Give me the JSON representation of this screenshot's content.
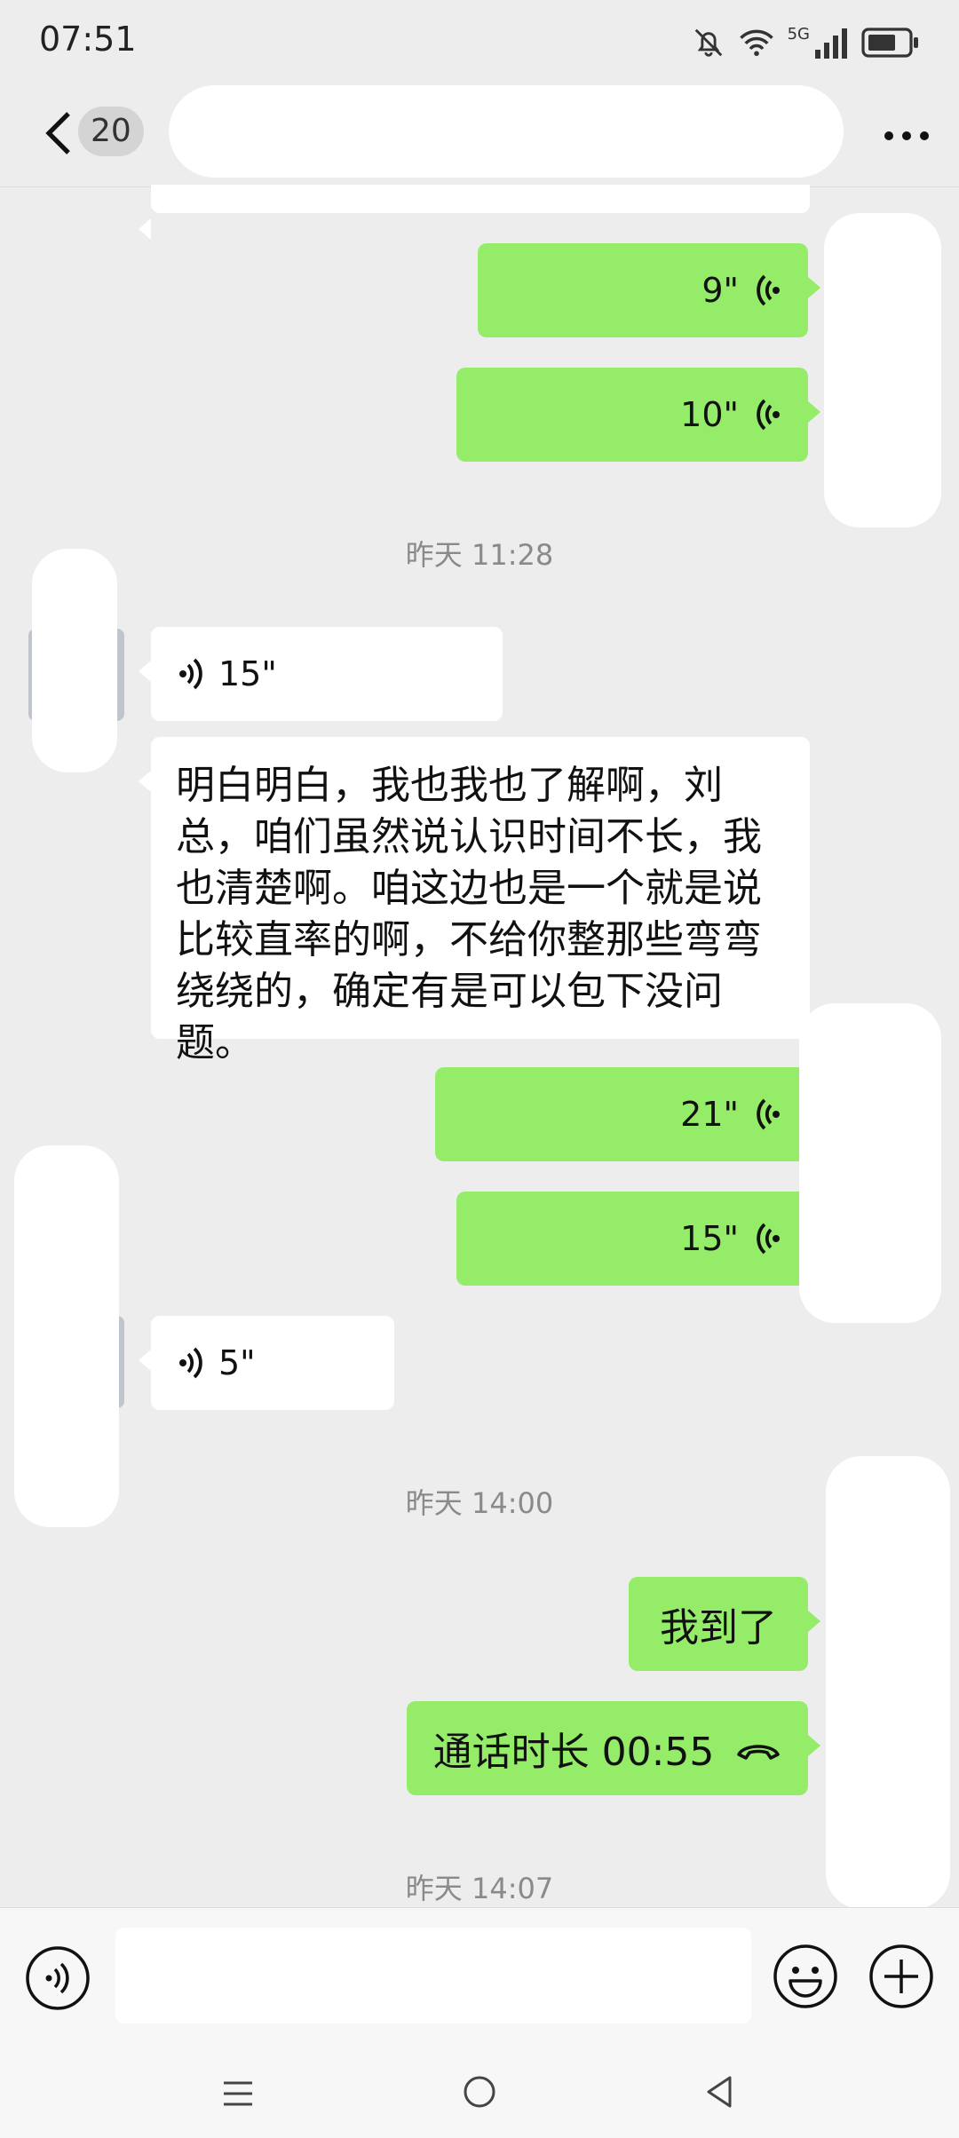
{
  "status_bar": {
    "time": "07:51",
    "network_label": "5G",
    "icons": [
      "bell-off-icon",
      "wifi-icon",
      "signal-icon",
      "battery-icon"
    ]
  },
  "header": {
    "unread_count": "20",
    "back_icon": "chevron-left-icon",
    "more_icon": "more-dots-icon"
  },
  "colors": {
    "outgoing_bubble": "#95ec69",
    "incoming_bubble": "#ffffff",
    "background": "#ededed"
  },
  "messages": [
    {
      "direction": "out",
      "type": "voice",
      "duration": "9\""
    },
    {
      "direction": "out",
      "type": "voice",
      "duration": "10\""
    },
    {
      "type": "timestamp",
      "text": "昨天 11:28"
    },
    {
      "direction": "in",
      "type": "voice",
      "duration": "15\""
    },
    {
      "direction": "in",
      "type": "text",
      "text": "明白明白，我也我也了解啊，刘总，咱们虽然说认识时间不长，我也清楚啊。咱这边也是一个就是说比较直率的啊，不给你整那些弯弯绕绕的，确定有是可以包下没问题。"
    },
    {
      "direction": "out",
      "type": "voice",
      "duration": "21\""
    },
    {
      "direction": "out",
      "type": "voice",
      "duration": "15\""
    },
    {
      "direction": "in",
      "type": "voice",
      "duration": "5\""
    },
    {
      "type": "timestamp",
      "text": "昨天 14:00"
    },
    {
      "direction": "out",
      "type": "text",
      "text": "我到了"
    },
    {
      "direction": "out",
      "type": "call",
      "text": "通话时长 00:55"
    },
    {
      "type": "timestamp",
      "text": "昨天 14:07"
    }
  ],
  "input_bar": {
    "text_value": "",
    "icons": [
      "voice-mode-icon",
      "emoji-icon",
      "plus-icon"
    ]
  },
  "nav_bar": {
    "icons": [
      "menu-icon",
      "home-icon",
      "back-triangle-icon"
    ]
  }
}
